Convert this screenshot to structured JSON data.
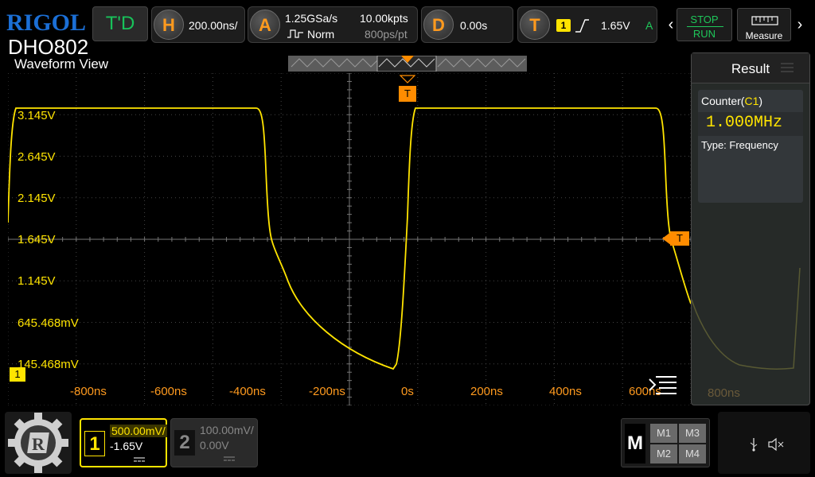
{
  "brand": {
    "logo": "RIGOL",
    "model": "DHO802"
  },
  "topbar": {
    "td_label": "T'D",
    "horizontal": {
      "key": "H",
      "timebase": "200.00ns/"
    },
    "acquire": {
      "key": "A",
      "sample_rate": "1.25GSa/s",
      "mode": "Norm",
      "memory_depth": "10.00kpts",
      "point_interval": "800ps/pt"
    },
    "delay": {
      "key": "D",
      "value": "0.00s"
    },
    "trigger": {
      "key": "T",
      "source": "1",
      "level": "1.65V",
      "status": "A"
    },
    "stop_label": "STOP",
    "run_label": "RUN",
    "measure_label": "Measure"
  },
  "waveform": {
    "title": "Waveform View",
    "trigger_marker": "T",
    "channel_marker": "1",
    "volt_labels": [
      "3.145V",
      "2.645V",
      "2.145V",
      "1.645V",
      "1.145V",
      "645.468mV",
      "145.468mV"
    ],
    "time_labels": [
      "-800ns",
      "-600ns",
      "-400ns",
      "-200ns",
      "0s",
      "200ns",
      "400ns",
      "600ns",
      "800ns"
    ],
    "trace_color": "#ffe400"
  },
  "result": {
    "title": "Result",
    "counter_label": "Counter(",
    "counter_source": "C1",
    "counter_close": ")",
    "counter_value": "1.000MHz",
    "type_line": "Type:  Frequency"
  },
  "channels": [
    {
      "num": "1",
      "scale": "500.00mV/",
      "offset": "-1.65V",
      "active": true
    },
    {
      "num": "2",
      "scale": "100.00mV/",
      "offset": "0.00V",
      "active": false
    }
  ],
  "math": {
    "label": "M",
    "buttons": [
      "M1",
      "M3",
      "M2",
      "M4"
    ]
  },
  "colors": {
    "ch1": "#ffe400",
    "trigger": "#ff8c00",
    "run_green": "#1ec85a",
    "logo_blue": "#1b6fd6"
  }
}
